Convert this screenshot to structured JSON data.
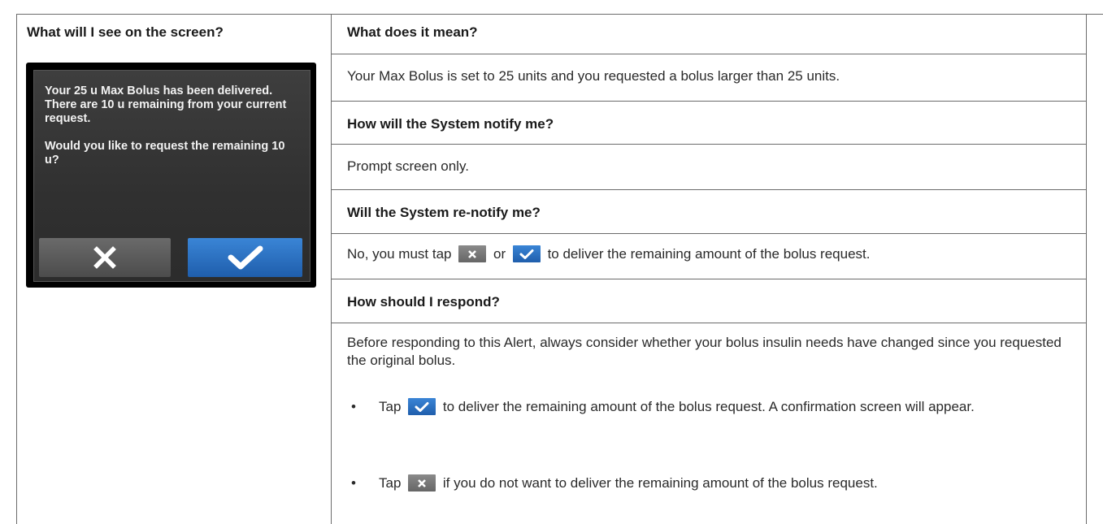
{
  "left": {
    "header": "What will I see on the screen?",
    "screen": {
      "message_p1": "Your 25 u Max Bolus has been delivered. There are 10 u remaining from your current request.",
      "message_p2": "Would you like to request the remaining 10 u?",
      "cancel_icon": "x-icon",
      "confirm_icon": "check-icon"
    }
  },
  "rows": {
    "meaning": {
      "heading": "What does it mean?",
      "text": "Your Max Bolus is set to 25 units and you requested a bolus larger than 25 units."
    },
    "notify": {
      "heading": "How will the System notify me?",
      "text": "Prompt screen only."
    },
    "renotify": {
      "heading": "Will the System re-notify me?",
      "text_before": "No, you must tap",
      "text_or": "or",
      "text_after": "to deliver the remaining amount of the bolus request."
    },
    "respond": {
      "heading": "How should I respond?",
      "intro": "Before responding to this Alert, always consider whether your bolus insulin needs have changed since you requested the original bolus.",
      "bullet1_tap": "Tap",
      "bullet1_text": "to deliver the remaining amount of the bolus request. A confirmation screen will appear.",
      "bullet2_tap": "Tap",
      "bullet2_text": "if you do not want to deliver the remaining amount of the bolus request.",
      "bullet_symbol": "•"
    }
  },
  "colors": {
    "confirm_blue": "#2a6fc2",
    "cancel_gray": "#5a5a5a",
    "border": "#6b6b6b"
  }
}
